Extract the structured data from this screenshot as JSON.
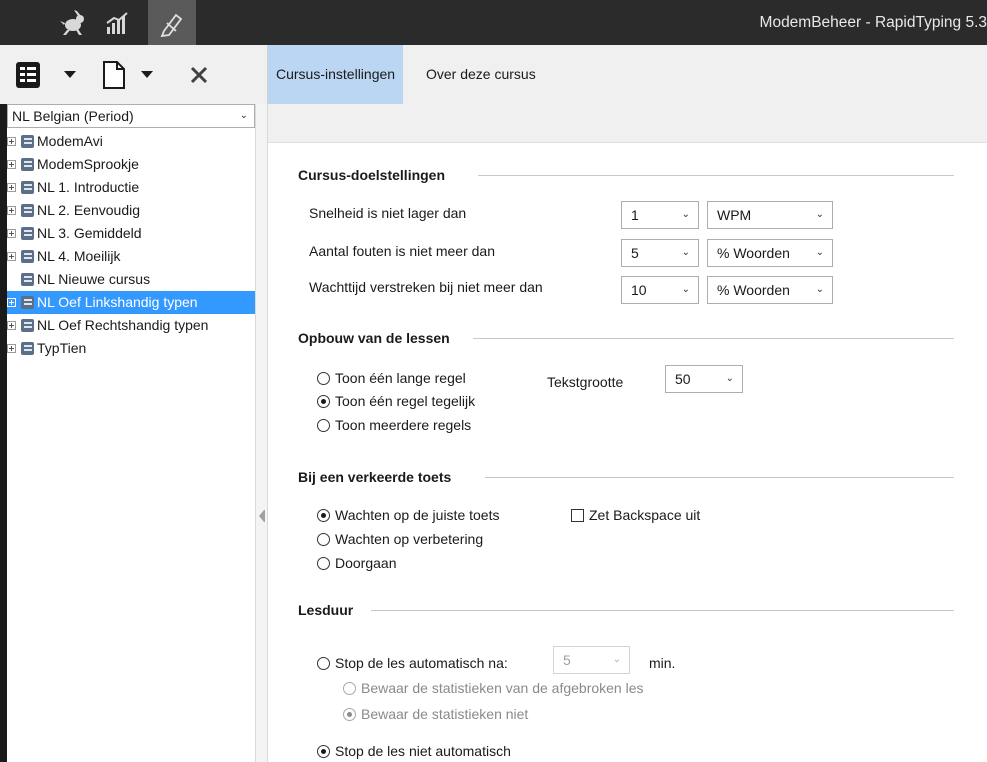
{
  "window": {
    "title": "ModemBeheer - RapidTyping 5.3"
  },
  "titlebar": {
    "icons": [
      "rabbit-icon",
      "stats-icon",
      "editor-icon"
    ]
  },
  "left_toolbar": {
    "icons": [
      "course-book-icon",
      "dropdown-arrow-icon",
      "new-document-icon",
      "dropdown-arrow-icon",
      "delete-icon"
    ]
  },
  "course_select": {
    "value": "NL Belgian (Period)"
  },
  "tree": {
    "items": [
      {
        "label": "ModemAvi",
        "expandable": true
      },
      {
        "label": "ModemSprookje",
        "expandable": true
      },
      {
        "label": "NL 1. Introductie",
        "expandable": true
      },
      {
        "label": "NL 2. Eenvoudig",
        "expandable": true
      },
      {
        "label": "NL 3. Gemiddeld",
        "expandable": true
      },
      {
        "label": "NL 4. Moeilijk",
        "expandable": true
      },
      {
        "label": "NL Nieuwe cursus",
        "expandable": false
      },
      {
        "label": "NL Oef Linkshandig typen",
        "expandable": true,
        "selected": true
      },
      {
        "label": "NL Oef Rechtshandig typen",
        "expandable": true
      },
      {
        "label": "TypTien",
        "expandable": true
      }
    ]
  },
  "tabs": [
    {
      "label": "Cursus-instellingen",
      "active": true
    },
    {
      "label": "Over deze cursus",
      "active": false
    }
  ],
  "goals": {
    "heading": "Cursus-doelstellingen",
    "rows": [
      {
        "label": "Snelheid is niet lager dan",
        "value": "1",
        "unit": "WPM"
      },
      {
        "label": "Aantal fouten is niet meer dan",
        "value": "5",
        "unit": "% Woorden"
      },
      {
        "label": "Wachttijd verstreken bij niet meer dan",
        "value": "10",
        "unit": "% Woorden"
      }
    ]
  },
  "layout_section": {
    "heading": "Opbouw van de lessen",
    "options": [
      "Toon één lange regel",
      "Toon één regel tegelijk",
      "Toon meerdere regels"
    ],
    "selected_index": 1,
    "text_size_label": "Tekstgrootte",
    "text_size_value": "50"
  },
  "wrong_key": {
    "heading": "Bij een verkeerde toets",
    "options": [
      "Wachten op de juiste toets",
      "Wachten op verbetering",
      "Doorgaan"
    ],
    "selected_index": 0,
    "backspace_label": "Zet Backspace uit",
    "backspace_checked": false
  },
  "duration": {
    "heading": "Lesduur",
    "auto_stop_label": "Stop de les automatisch na:",
    "auto_stop_value": "5",
    "auto_stop_unit": "min.",
    "save_stats_label": "Bewaar de statistieken van de afgebroken les",
    "no_save_stats_label": "Bewaar de statistieken niet",
    "no_auto_stop_label": "Stop de les niet automatisch"
  },
  "colors": {
    "titlebar": "#2b2b2b",
    "selection": "#3399ff",
    "active_tab": "#bbd6f2"
  }
}
